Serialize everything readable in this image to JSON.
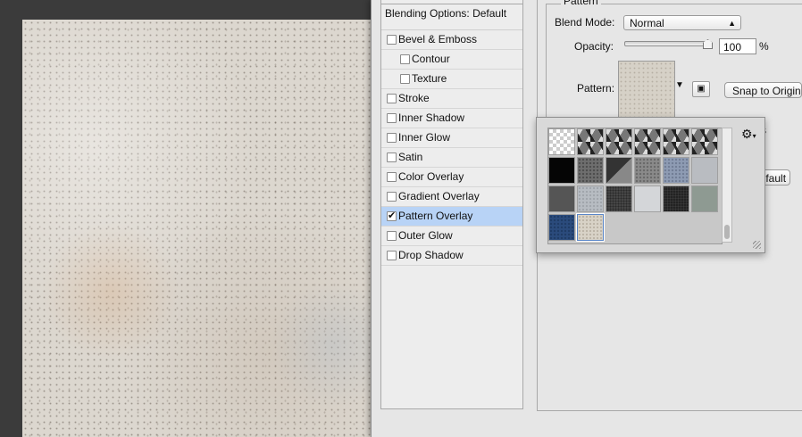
{
  "dialog": {
    "styles_header": "Blending Options: Default",
    "style_items": [
      {
        "label": "Bevel & Emboss",
        "checked": false,
        "indent": false
      },
      {
        "label": "Contour",
        "checked": false,
        "indent": true
      },
      {
        "label": "Texture",
        "checked": false,
        "indent": true
      },
      {
        "label": "Stroke",
        "checked": false,
        "indent": false
      },
      {
        "label": "Inner Shadow",
        "checked": false,
        "indent": false
      },
      {
        "label": "Inner Glow",
        "checked": false,
        "indent": false
      },
      {
        "label": "Satin",
        "checked": false,
        "indent": false
      },
      {
        "label": "Color Overlay",
        "checked": false,
        "indent": false
      },
      {
        "label": "Gradient Overlay",
        "checked": false,
        "indent": false
      },
      {
        "label": "Pattern Overlay",
        "checked": true,
        "indent": false,
        "selected": true
      },
      {
        "label": "Outer Glow",
        "checked": false,
        "indent": false
      },
      {
        "label": "Drop Shadow",
        "checked": false,
        "indent": false
      }
    ],
    "pattern_group": {
      "title": "Pattern",
      "blend_mode_label": "Blend Mode:",
      "blend_mode_value": "Normal",
      "opacity_label": "Opacity:",
      "opacity_value": "100",
      "opacity_unit": "%",
      "pattern_label": "Pattern:",
      "snap_button": "Snap to Origin",
      "default_button": "Default",
      "partial_text": "s"
    },
    "pattern_picker": {
      "gear_icon": "gear-icon",
      "swatches": [
        [
          "transparent-checker",
          "gray-cubes",
          "gray-cubes",
          "gray-cubes",
          "gray-cubes",
          "gray-cubes"
        ],
        [
          "black",
          "dark-gray-texture",
          "diagonal-dark",
          "gray-texture",
          "blue-gray-texture",
          "light-gray-texture"
        ],
        [
          "charcoal",
          "silver-texture",
          "dark-granite",
          "pale-gray",
          "black-texture",
          "sage-texture"
        ],
        [
          "navy-blue",
          "beige-stone"
        ]
      ],
      "selected_swatch": "beige-stone"
    }
  },
  "colors": {
    "selection": "#b8d3f6",
    "canvas_stone": "#dcd7cf",
    "panel_bg": "#e6e6e6"
  }
}
